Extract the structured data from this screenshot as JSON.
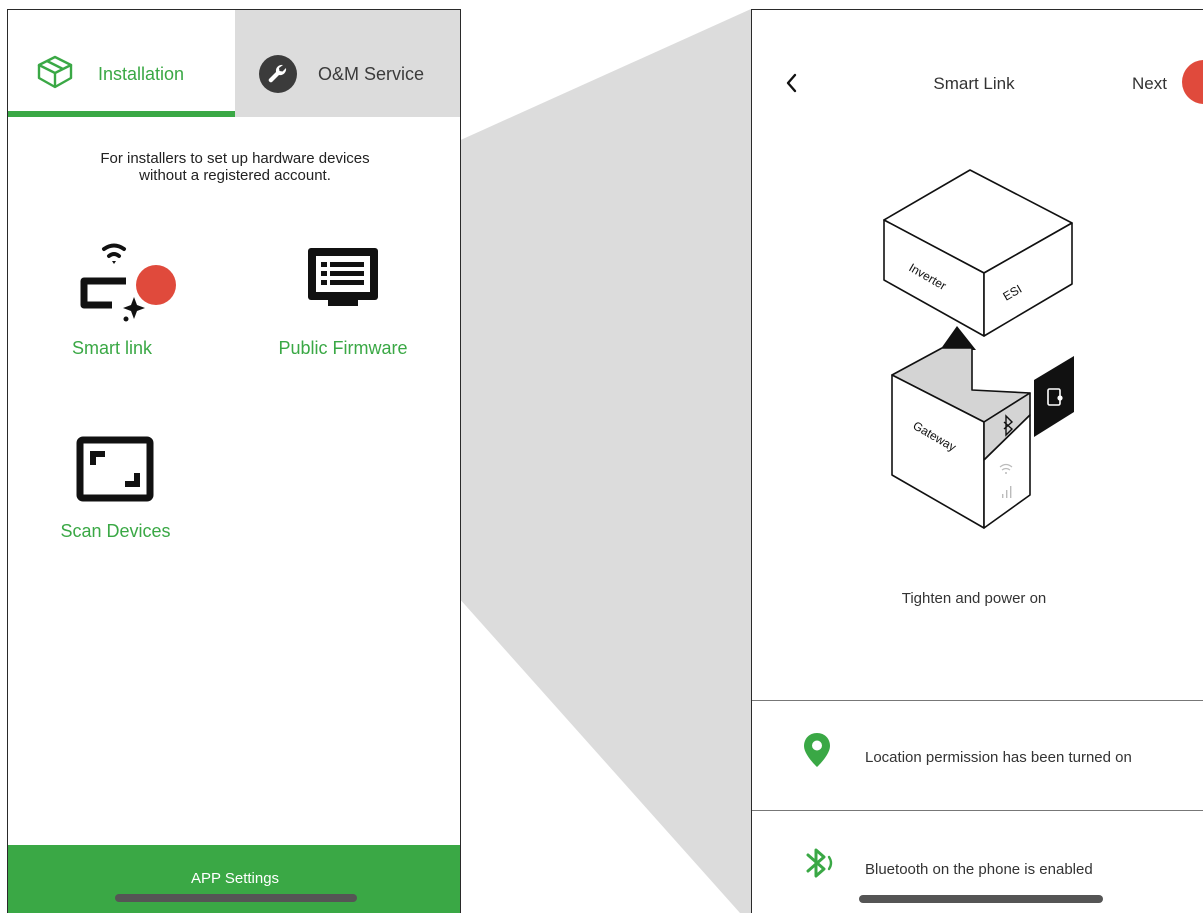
{
  "left_screen": {
    "tabs": [
      {
        "label": "Installation",
        "icon": "package-box-icon",
        "active": true
      },
      {
        "label": "O&M Service",
        "icon": "wrench-icon",
        "active": false
      }
    ],
    "intro_lines": [
      "For installers to set up hardware devices",
      "without a registered account."
    ],
    "features": [
      {
        "label": "Smart link",
        "icon": "smart-link-icon"
      },
      {
        "label": "Public Firmware",
        "icon": "firmware-monitor-icon"
      },
      {
        "label": "Scan Devices",
        "icon": "scan-frame-icon"
      }
    ],
    "bottom_bar": {
      "label": "APP Settings"
    }
  },
  "right_screen": {
    "header": {
      "back_icon": "chevron-left-icon",
      "title": "Smart Link",
      "next_label": "Next"
    },
    "illustration": {
      "box_top_labels": [
        "Inverter",
        "ESI"
      ],
      "box_bottom_label": "Gateway"
    },
    "step_caption": "Tighten and power on",
    "status_rows": [
      {
        "icon": "location-pin-icon",
        "text": "Location permission has been turned on"
      },
      {
        "icon": "bluetooth-icon",
        "text": "Bluetooth on the phone is enabled"
      }
    ]
  },
  "colors": {
    "accent_green": "#3aa845",
    "highlight_red": "#e04a3c",
    "callout_gray": "#dcdcdc",
    "inactive_tab": "#dcdcdc"
  }
}
